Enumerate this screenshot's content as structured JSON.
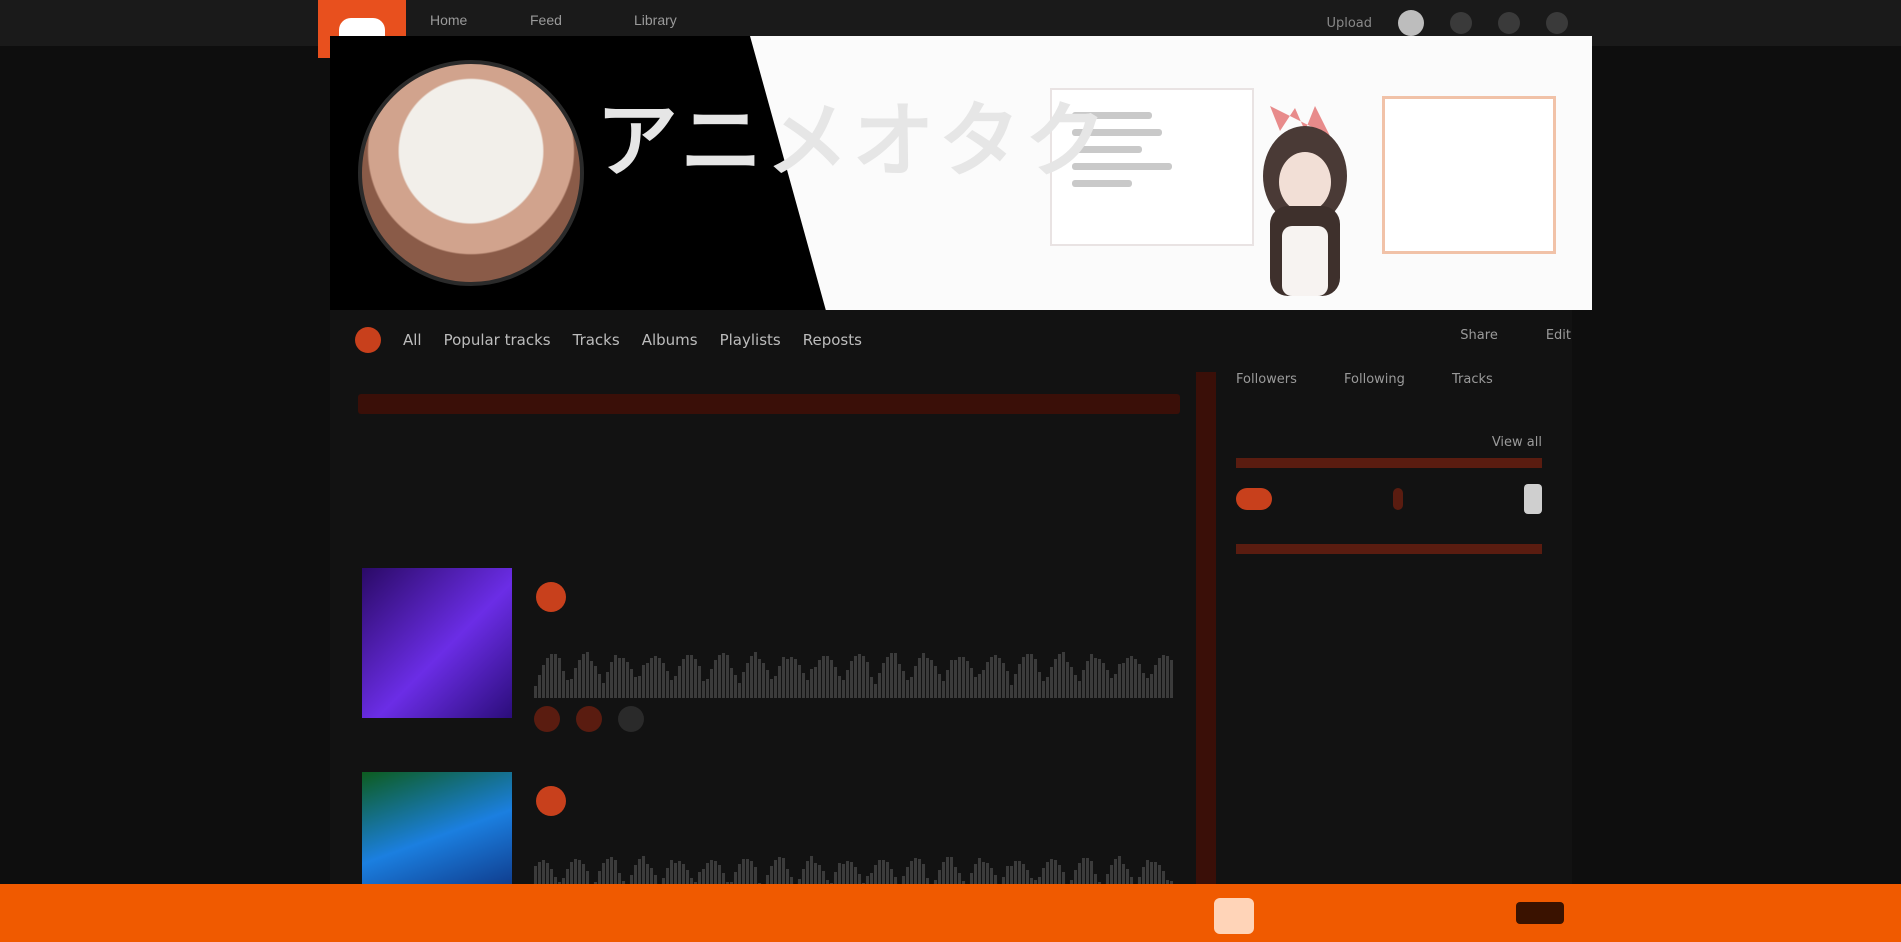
{
  "topbar": {
    "nav": [
      "Home",
      "Feed",
      "Library"
    ],
    "upload_label": "Upload"
  },
  "header": {
    "small_name": "",
    "big_name": "アニメオタク"
  },
  "profile_tabs": [
    "All",
    "Popular tracks",
    "Tracks",
    "Albums",
    "Playlists",
    "Reposts"
  ],
  "profile_actions": [
    "Share",
    "Edit"
  ],
  "main": {
    "spotlight_title": "",
    "spotlight_desc": "",
    "stream_title": "",
    "tracks": [
      {
        "user": "",
        "title": "",
        "date": "",
        "genre": "",
        "plays": ""
      },
      {
        "user": "",
        "title": "",
        "date": "",
        "genre": "",
        "plays": ""
      }
    ]
  },
  "sidebar": {
    "stats": [
      {
        "label": "Followers",
        "value": ""
      },
      {
        "label": "Following",
        "value": ""
      },
      {
        "label": "Tracks",
        "value": ""
      }
    ],
    "bio": "",
    "likes_label": "",
    "view_all": "View all",
    "following_label": "",
    "recent_label": ""
  },
  "colors": {
    "accent": "#f05a00",
    "dark_bg": "#121212",
    "brand_red": "#c8401c"
  }
}
